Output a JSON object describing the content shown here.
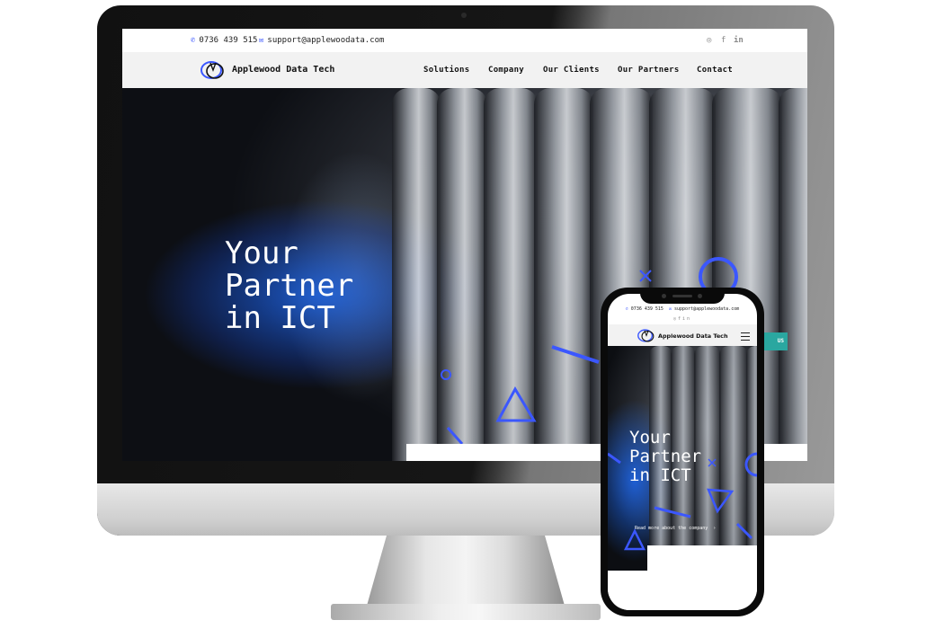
{
  "desktop": {
    "topbar": {
      "phone": "0736 439 515",
      "email": "support@applewoodata.com",
      "social": [
        "whatsapp-icon",
        "facebook-icon",
        "linkedin-icon"
      ]
    },
    "brand": "Applewood Data Tech",
    "nav": [
      "Solutions",
      "Company",
      "Our Clients",
      "Our Partners",
      "Contact"
    ],
    "hero": {
      "line1": "Your",
      "line2": "Partner",
      "line3": "in ICT"
    }
  },
  "mobile": {
    "phone": "0736 439 515",
    "email": "support@applewoodata.com",
    "brand": "Applewood Data Tech",
    "hero": {
      "line1": "Your",
      "line2": "Partner",
      "line3": "in ICT",
      "cta": "Read more about the company"
    }
  },
  "colors": {
    "accent": "#3b57ff",
    "teal": "#2aa7a0",
    "navbar": "#f2f2f2"
  }
}
